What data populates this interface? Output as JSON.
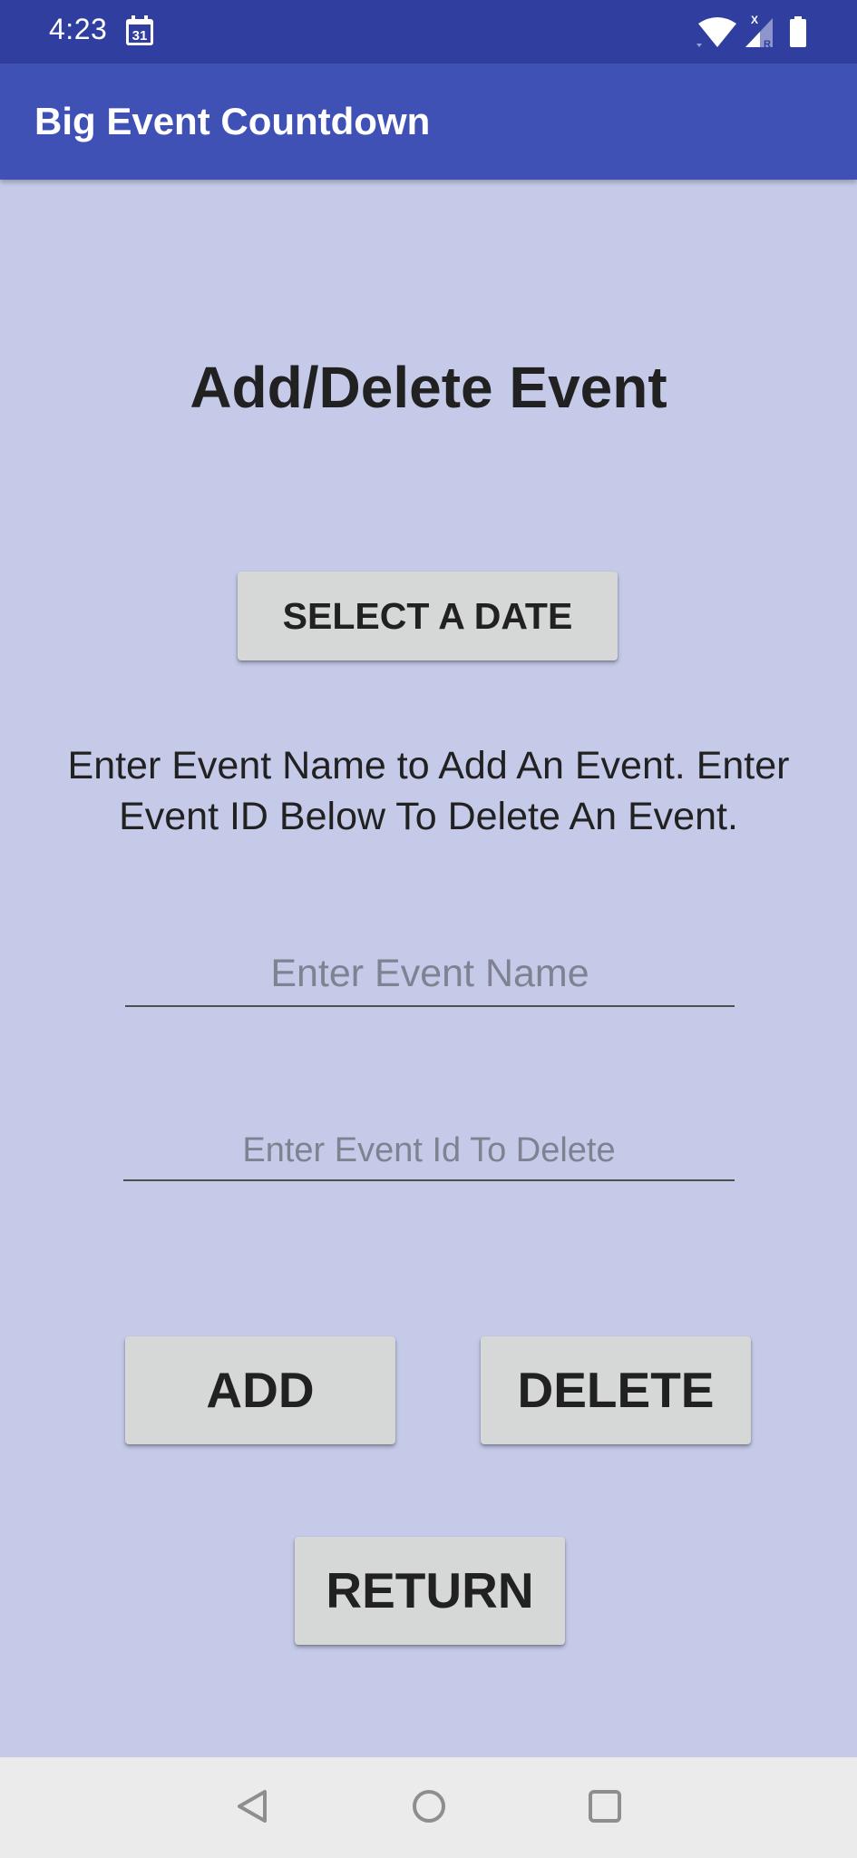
{
  "status_bar": {
    "time": "4:23",
    "calendar_day": "31",
    "signal_badge_x": "X",
    "signal_badge_r": "R",
    "icons": [
      "calendar-icon",
      "wifi-icon",
      "signal-icon",
      "battery-icon"
    ]
  },
  "app_bar": {
    "title": "Big Event Countdown"
  },
  "main": {
    "heading": "Add/Delete Event",
    "select_date_label": "SELECT A DATE",
    "instructions": "Enter Event Name to Add An Event. Enter Event ID Below To Delete An Event.",
    "event_name_field": {
      "value": "",
      "placeholder": "Enter Event Name"
    },
    "event_id_field": {
      "value": "",
      "placeholder": "Enter Event Id To Delete"
    },
    "add_label": "ADD",
    "delete_label": "DELETE",
    "return_label": "RETURN"
  },
  "nav_bar": {
    "icons": [
      "back-icon",
      "home-icon",
      "recents-icon"
    ]
  },
  "colors": {
    "status_bar": "#303f9f",
    "app_bar": "#3f51b5",
    "background": "#c5cae9",
    "button": "#d6d7d7",
    "nav_bar": "#ebebeb"
  }
}
